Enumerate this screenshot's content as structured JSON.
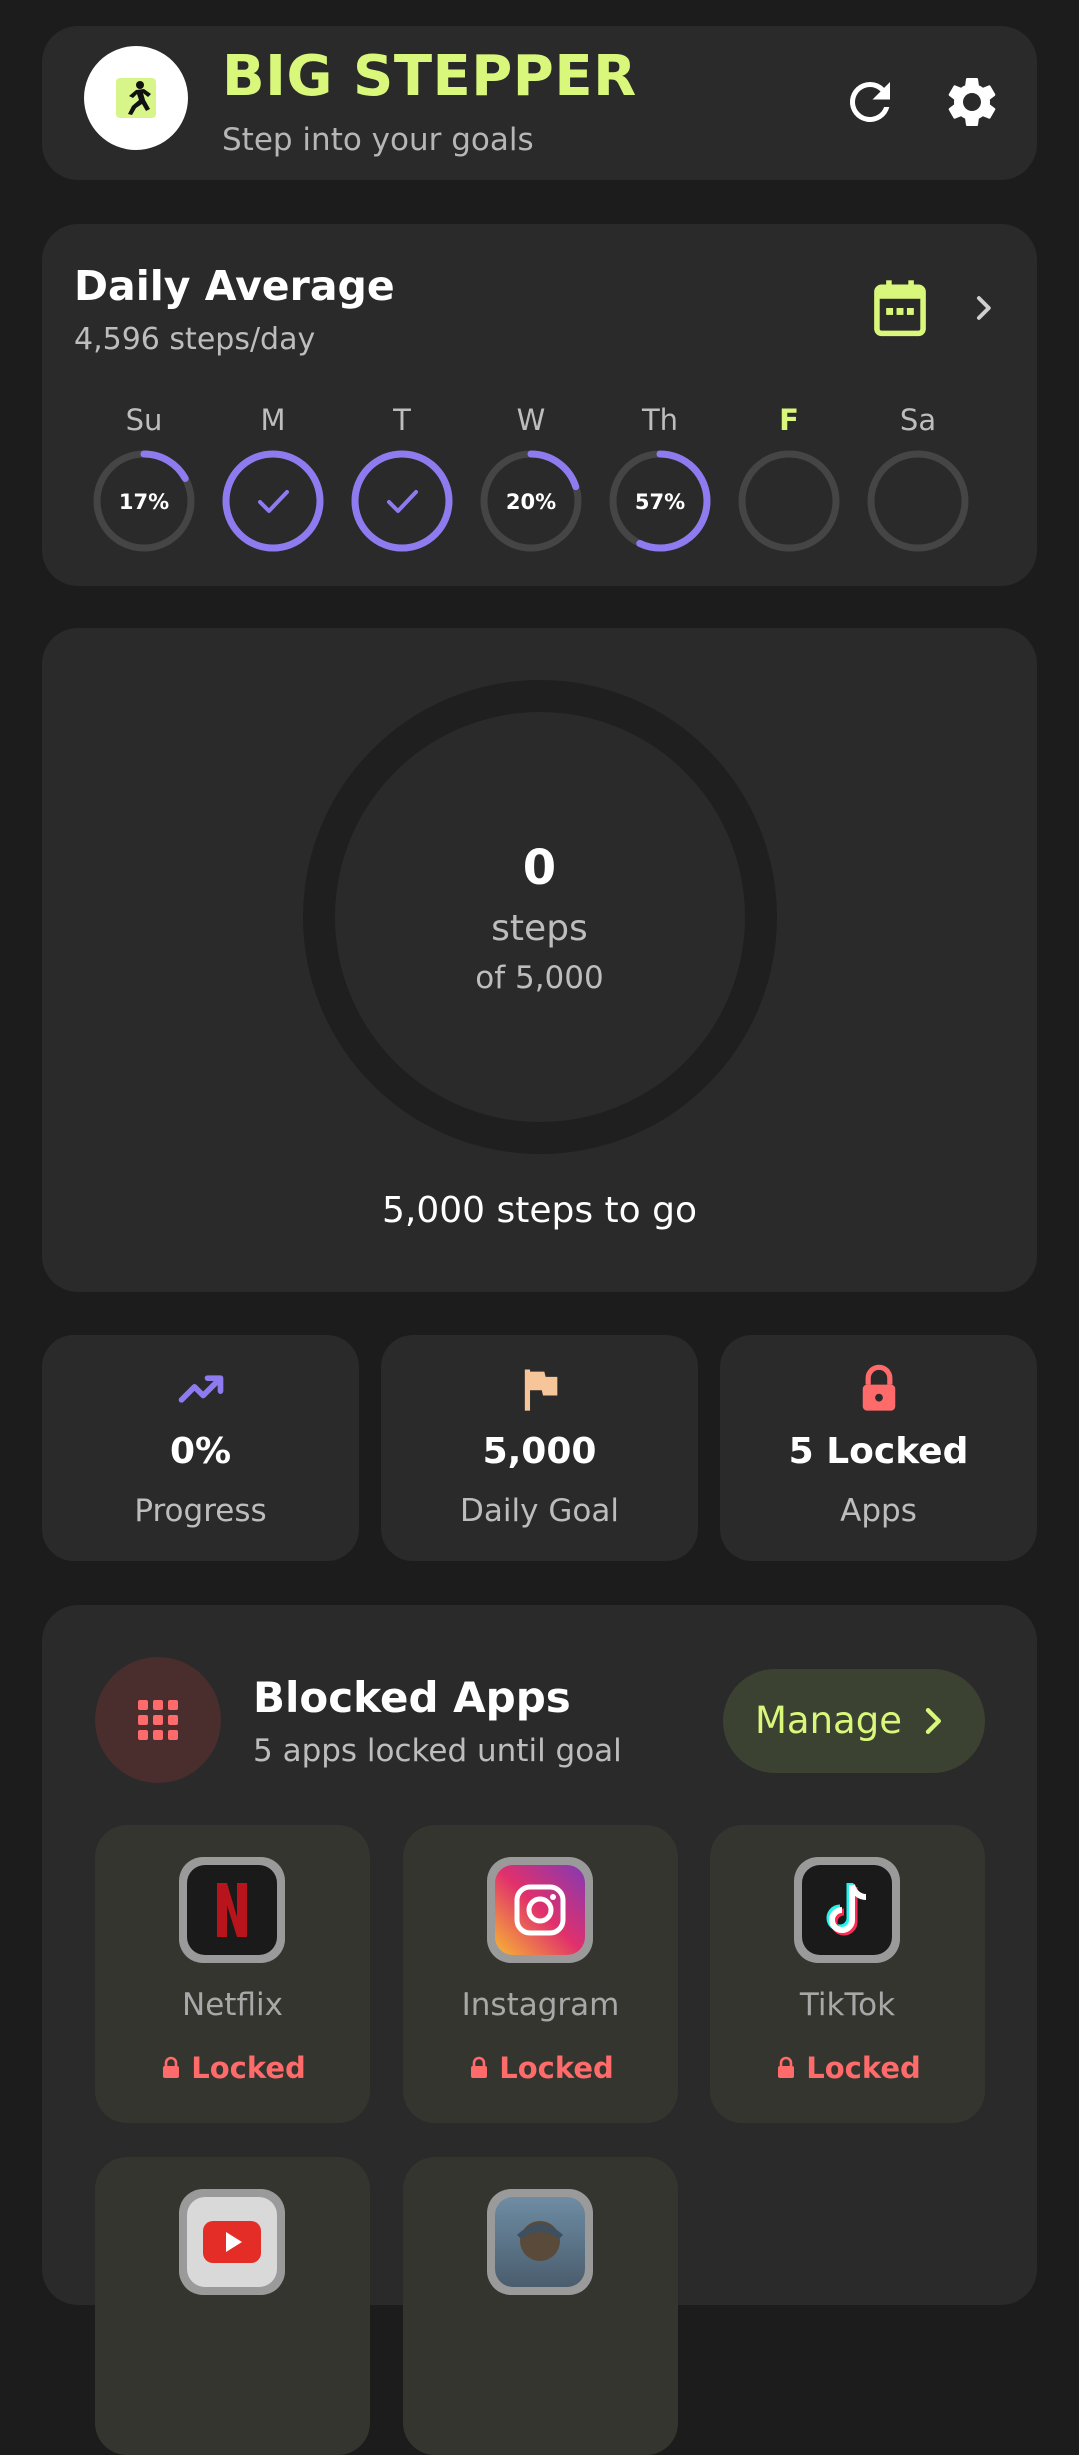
{
  "header": {
    "title": "BIG STEPPER",
    "subtitle": "Step into your goals",
    "logo_icon": "runner-icon",
    "refresh_icon": "refresh-icon",
    "settings_icon": "gear-icon"
  },
  "daily_average": {
    "title": "Daily Average",
    "subtitle": "4,596 steps/day",
    "calendar_icon": "calendar-icon",
    "days": [
      {
        "label": "Su",
        "progress": 0.17,
        "text": "17%",
        "complete": false,
        "today": false
      },
      {
        "label": "M",
        "progress": 1.0,
        "text": "",
        "complete": true,
        "today": false
      },
      {
        "label": "T",
        "progress": 1.0,
        "text": "",
        "complete": true,
        "today": false
      },
      {
        "label": "W",
        "progress": 0.2,
        "text": "20%",
        "complete": false,
        "today": false
      },
      {
        "label": "Th",
        "progress": 0.57,
        "text": "57%",
        "complete": false,
        "today": false
      },
      {
        "label": "F",
        "progress": 0.0,
        "text": "",
        "complete": false,
        "today": true
      },
      {
        "label": "Sa",
        "progress": 0.0,
        "text": "",
        "complete": false,
        "today": false
      }
    ]
  },
  "steps": {
    "count": "0",
    "unit": "steps",
    "of_goal": "of 5,000",
    "remaining": "5,000 steps to go",
    "progress": 0.0
  },
  "stats": [
    {
      "icon": "trending-up-icon",
      "value": "0%",
      "label": "Progress"
    },
    {
      "icon": "flag-icon",
      "value": "5,000",
      "label": "Daily Goal"
    },
    {
      "icon": "lock-icon",
      "value": "5 Locked",
      "label": "Apps"
    }
  ],
  "blocked_apps": {
    "title": "Blocked Apps",
    "subtitle": "5 apps locked until goal",
    "manage_label": "Manage",
    "apps": [
      {
        "name": "Netflix",
        "status": "Locked",
        "icon": "netflix-icon"
      },
      {
        "name": "Instagram",
        "status": "Locked",
        "icon": "instagram-icon"
      },
      {
        "name": "TikTok",
        "status": "Locked",
        "icon": "tiktok-icon"
      },
      {
        "name": "",
        "status": "",
        "icon": "youtube-icon"
      },
      {
        "name": "",
        "status": "",
        "icon": "game-app-icon"
      }
    ]
  },
  "colors": {
    "accent": "#d9f77a",
    "ring": "#8f7bf0",
    "lock": "#ff6b6b",
    "card": "#2a2a2a",
    "background": "#1c1c1c"
  }
}
